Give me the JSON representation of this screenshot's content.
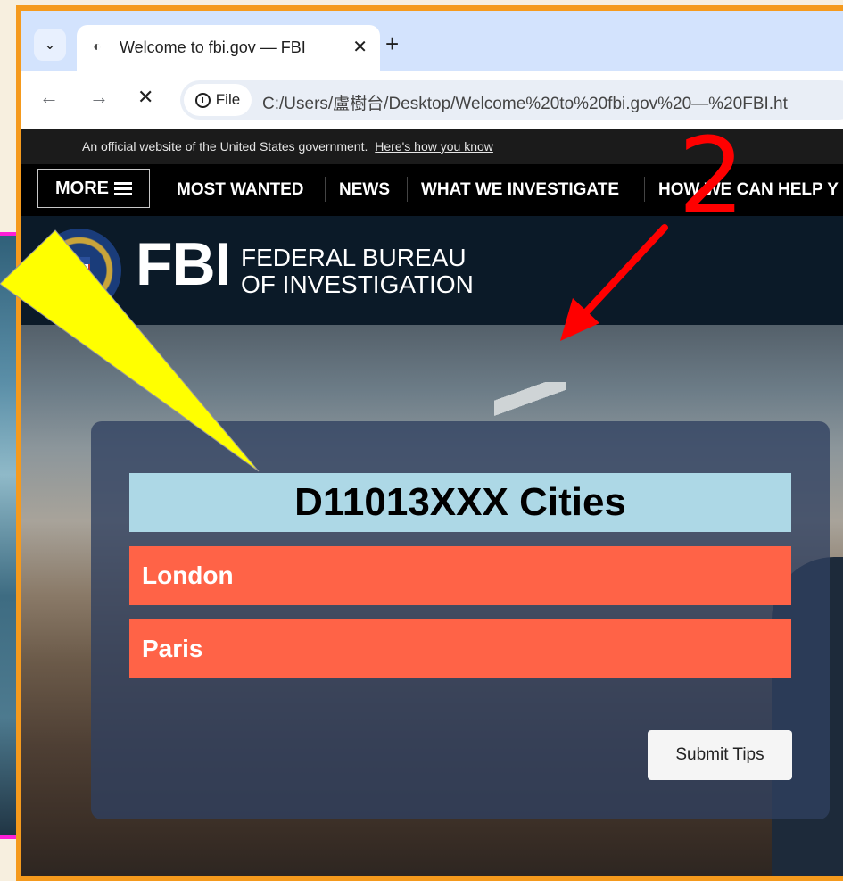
{
  "browser": {
    "tab_title": "Welcome to fbi.gov — FBI",
    "tab_close": "✕",
    "new_tab": "+",
    "site_chip_label": "File",
    "url": "C:/Users/盧樹台/Desktop/Welcome%20to%20fbi.gov%20—%20FBI.ht"
  },
  "gov_banner": {
    "text": "An official website of the United States government.",
    "link": "Here's how you know"
  },
  "nav": {
    "more": "MORE",
    "items": [
      "MOST WANTED",
      "NEWS",
      "WHAT WE INVESTIGATE",
      "HOW WE CAN HELP Y"
    ]
  },
  "header": {
    "logo": "FBI",
    "sub_line1": "FEDERAL BUREAU",
    "sub_line2": "OF INVESTIGATION"
  },
  "panel": {
    "title": "D11013XXX Cities",
    "cities": [
      "London",
      "Paris"
    ],
    "submit_label": "Submit Tips"
  },
  "annotation": {
    "number": "2",
    "arrow_color": "#ff0000",
    "callout_color": "#ffff00"
  }
}
